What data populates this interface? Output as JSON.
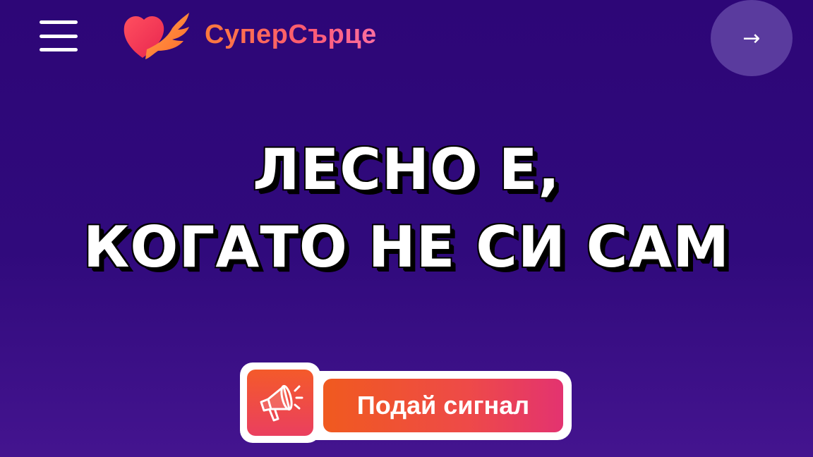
{
  "header": {
    "menu_icon": "hamburger-menu-icon",
    "logo_icon": "winged-heart-icon",
    "logo_text": "СуперСърце",
    "arrow_icon": "arrow-right-icon",
    "arrow_glyph": "→"
  },
  "hero": {
    "line1": "ЛЕСНО Е,",
    "line2": "КОГАТО НЕ СИ САМ"
  },
  "cta": {
    "icon": "megaphone-icon",
    "label": "Подай сигнал"
  },
  "colors": {
    "background": "#2d0677",
    "accent_orange": "#f05a1f",
    "accent_pink": "#e33370",
    "arrow_button": "#5a3b9e"
  }
}
